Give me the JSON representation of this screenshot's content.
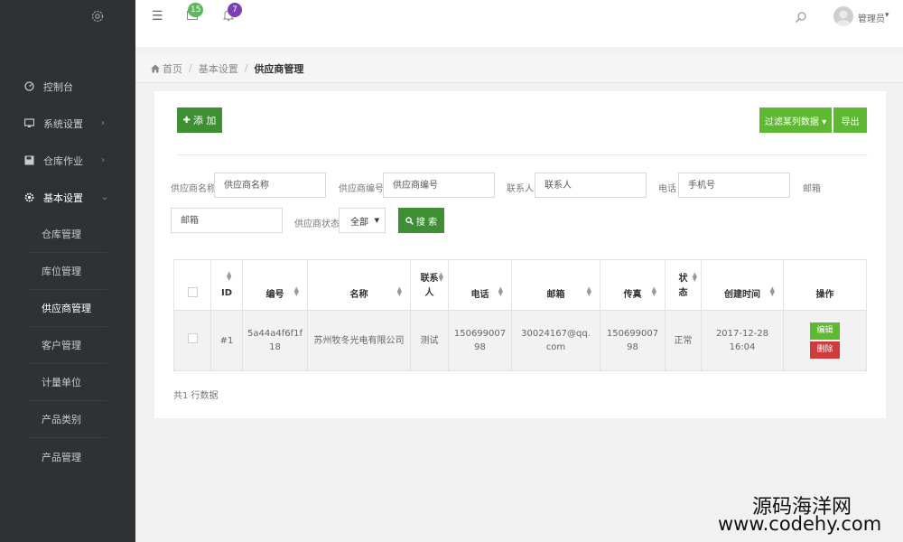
{
  "sidebar": {
    "items": [
      {
        "label": "控制台",
        "icon": "gauge-icon"
      },
      {
        "label": "系统设置",
        "icon": "monitor-icon",
        "chevron": "›"
      },
      {
        "label": "仓库作业",
        "icon": "save-icon",
        "chevron": "›"
      },
      {
        "label": "基本设置",
        "icon": "gear-icon",
        "chevron": "⌄"
      }
    ],
    "subitems": [
      "仓库管理",
      "库位管理",
      "供应商管理",
      "客户管理",
      "计量单位",
      "产品类别",
      "产品管理"
    ]
  },
  "topbar": {
    "mail_count": "15",
    "bell_count": "7",
    "user_name": "管理员",
    "menu_glyph": "☰",
    "caret": "▾"
  },
  "breadcrumb": {
    "home": "首页",
    "level2": "基本设置",
    "current": "供应商管理"
  },
  "toolbar": {
    "add_label": "添 加",
    "add_glyph": "✚",
    "filter_label": "过滤某列数据 ▾",
    "export_label": "导出"
  },
  "filters": {
    "supplier_name_label": "供应商名称",
    "supplier_name_placeholder": "供应商名称",
    "supplier_code_label": "供应商编号",
    "supplier_code_placeholder": "供应商编号",
    "contact_label": "联系人",
    "contact_placeholder": "联系人",
    "phone_label": "电话",
    "phone_placeholder": "手机号",
    "email_label": "邮箱",
    "email_placeholder": "邮箱",
    "status_label": "供应商状态",
    "status_value": "全部",
    "search_label": "搜 索"
  },
  "table": {
    "headers": [
      "ID",
      "编号",
      "名称",
      "联系人",
      "电话",
      "邮箱",
      "传真",
      "状态",
      "创建时间",
      "操作"
    ],
    "rows": [
      {
        "id": "#1",
        "code": "5a44a4f6f1f18",
        "name": "苏州牧冬光电有限公司",
        "contact": "测试",
        "phone": "15069900798",
        "email": "30024167@qq.com",
        "fax": "15069900798",
        "status": "正常",
        "created": "2017-12-28 16:04",
        "edit_label": "编辑",
        "delete_label": "删除"
      }
    ],
    "total_text": "共1 行数据"
  },
  "watermark": {
    "line1": "源码海洋网",
    "line2": "www.codehy.com"
  }
}
